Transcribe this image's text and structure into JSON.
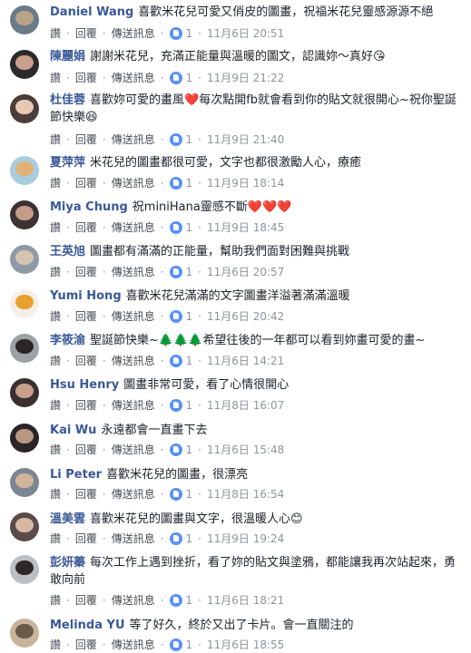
{
  "labels": {
    "like": "讚",
    "reply": "回覆",
    "message": "傳送訊息",
    "sep": "·"
  },
  "colors": {
    "name": "#385898",
    "meta": "#90949c",
    "like_badge": "#5890ff",
    "heart": "#e0245e"
  },
  "comments": [
    {
      "name": "Daniel Wang",
      "text": "喜歡米花兒可愛又俏皮的圖畫，祝福米花兒靈感源源不絕",
      "emoji": "",
      "likes": "1",
      "time": "11月6日 20:51",
      "avatar_colors": [
        "#6a7a88",
        "#b9a48a"
      ]
    },
    {
      "name": "陳麗娟",
      "text": "謝謝米花兒，充滿正能量與溫暖的圖文，認識妳～真好",
      "emoji": "😘",
      "likes": "1",
      "time": "11月9日 21:22",
      "avatar_colors": [
        "#2d2a2b",
        "#c89f8c"
      ]
    },
    {
      "name": "杜佳蓉",
      "text": "喜歡妳可愛的畫風❤️每次點開fb就會看到你的貼文就很開心~祝你聖誕節快樂",
      "emoji": "😆",
      "likes": "1",
      "time": "11月9日 21:40",
      "avatar_colors": [
        "#4a3d3a",
        "#e6c8b4"
      ]
    },
    {
      "name": "夏萍萍",
      "text": "米花兒的圖畫都很可愛，文字也都很激勵人心，療癒",
      "emoji": "",
      "likes": "1",
      "time": "11月9日 18:14",
      "avatar_colors": [
        "#a9cde0",
        "#e0b277"
      ]
    },
    {
      "name": "Miya Chung",
      "text": "祝miniHana靈感不斷",
      "emoji": "❤️❤️❤️",
      "likes": "1",
      "time": "11月9日 18:45",
      "avatar_colors": [
        "#3c3234",
        "#c59c88"
      ]
    },
    {
      "name": "王英旭",
      "text": "圖畫都有滿滿的正能量，幫助我們面對困難與挑戰",
      "emoji": "",
      "likes": "1",
      "time": "11月6日 20:57",
      "avatar_colors": [
        "#8f9aa8",
        "#d4c4b0"
      ]
    },
    {
      "name": "Yumi Hong",
      "text": "喜歡米花兒滿滿的文字圖畫洋溢著滿滿溫暖",
      "emoji": "",
      "likes": "1",
      "time": "11月6日 20:42",
      "avatar_colors": [
        "#f4f0e8",
        "#e8a030"
      ]
    },
    {
      "name": "李筱渝",
      "text": "聖誕節快樂~🌲🌲🌲希望往後的一年都可以看到妳畫可愛的畫~",
      "emoji": "",
      "likes": "1",
      "time": "11月6日 14:21",
      "avatar_colors": [
        "#9aa2a4",
        "#2a2626"
      ]
    },
    {
      "name": "Hsu Henry",
      "text": "圖畫非常可愛，看了心情很開心",
      "emoji": "",
      "likes": "1",
      "time": "11月8日 16:07",
      "avatar_colors": [
        "#3a3032",
        "#c8a08c"
      ]
    },
    {
      "name": "Kai Wu",
      "text": "永遠都會一直畫下去",
      "emoji": "",
      "likes": "1",
      "time": "11月6日 15:48",
      "avatar_colors": [
        "#2b2526",
        "#b89684"
      ]
    },
    {
      "name": "Li Peter",
      "text": "喜歡米花兒的圖畫，很漂亮",
      "emoji": "",
      "likes": "1",
      "time": "11月8日 16:54",
      "avatar_colors": [
        "#7c8692",
        "#d2b49a"
      ]
    },
    {
      "name": "溫美雲",
      "text": "喜歡米花兒的圖畫與文字，很溫暖人心",
      "emoji": "😊",
      "likes": "1",
      "time": "11月9日 19:24",
      "avatar_colors": [
        "#5a4c4a",
        "#d8b8a4"
      ]
    },
    {
      "name": "彭妍蓁",
      "text": "每次工作上遇到挫折，看了妳的貼文與塗鴉，都能讓我再次站起來，勇敢向前",
      "emoji": "",
      "likes": "1",
      "time": "11月6日 18:21",
      "avatar_colors": [
        "#bcc0c4",
        "#2e2828"
      ]
    },
    {
      "name": "Melinda YU",
      "text": "等了好久，終於又出了卡片。會一直關注的",
      "emoji": "",
      "likes": "1",
      "time": "11月6日 18:55",
      "avatar_colors": [
        "#c8b49a",
        "#6a5a4a"
      ]
    }
  ]
}
